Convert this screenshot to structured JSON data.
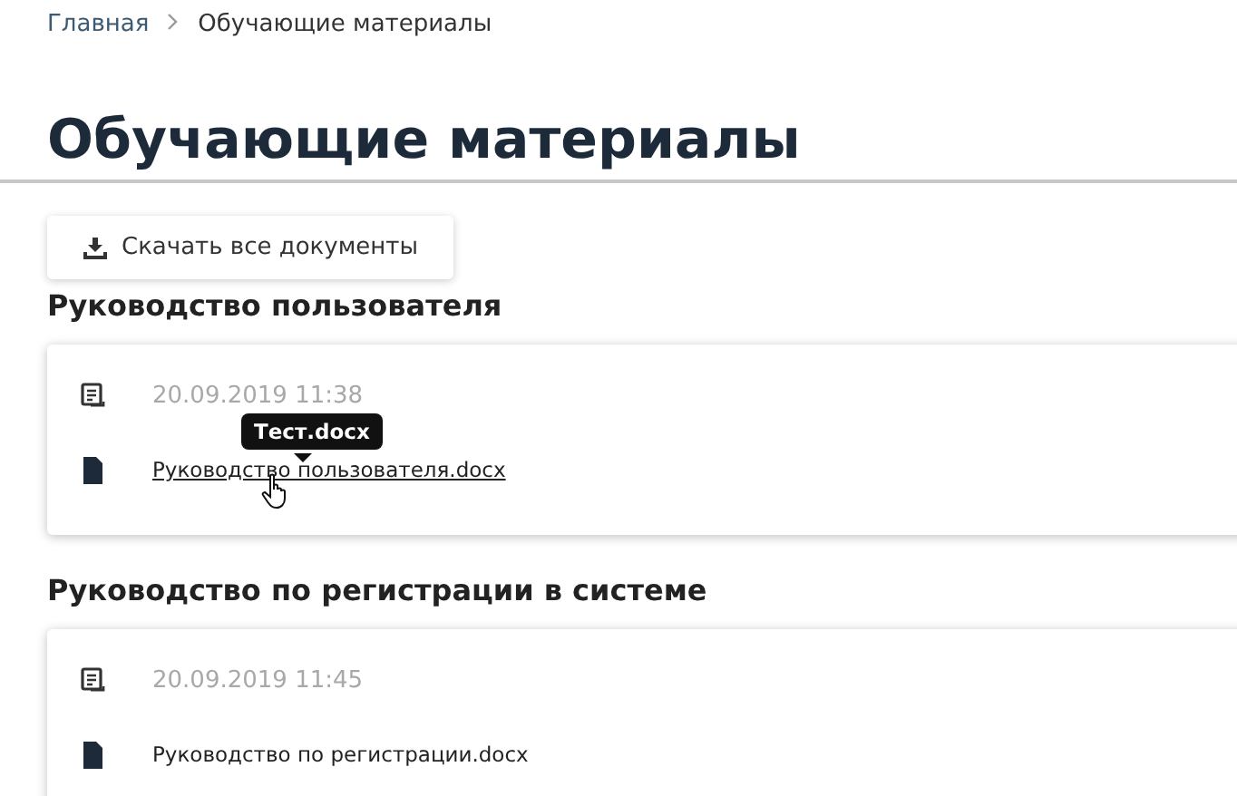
{
  "breadcrumbs": [
    {
      "label": "Главная",
      "link": true
    },
    {
      "label": "Обучающие материалы",
      "link": false
    }
  ],
  "title": "Обучающие материалы",
  "download_button": {
    "label": "Скачать все документы"
  },
  "sections": [
    {
      "heading": "Руководство пользователя",
      "date": "20.09.2019 11:38",
      "file": {
        "name": "Руководство пользователя.docx",
        "hovered": true,
        "tooltip": "Тест.docx"
      }
    },
    {
      "heading": "Руководство по регистрации в системе",
      "date": "20.09.2019 11:45",
      "file": {
        "name": "Руководство по регистрации.docx",
        "hovered": false
      }
    }
  ]
}
